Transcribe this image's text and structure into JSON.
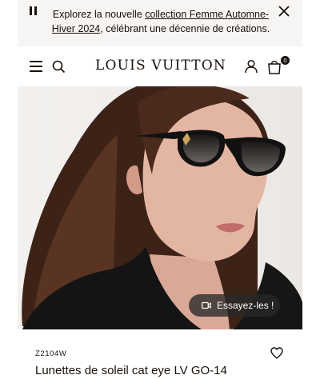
{
  "announcement": {
    "text_before": "Explorez la nouvelle ",
    "link_text": "collection Femme Automne-Hiver 2024",
    "text_after": ", célébrant une décennie de créations."
  },
  "header": {
    "brand": "LOUIS VUITTON",
    "bag_count": "0"
  },
  "product": {
    "try_on_label": "Essayez-les !",
    "sku": "Z2104W",
    "name": "Lunettes de soleil cat eye LV GO-14"
  },
  "icons": [
    "pause-icon",
    "close-icon",
    "menu-icon",
    "search-icon",
    "account-icon",
    "bag-icon",
    "camera-icon",
    "heart-icon"
  ]
}
